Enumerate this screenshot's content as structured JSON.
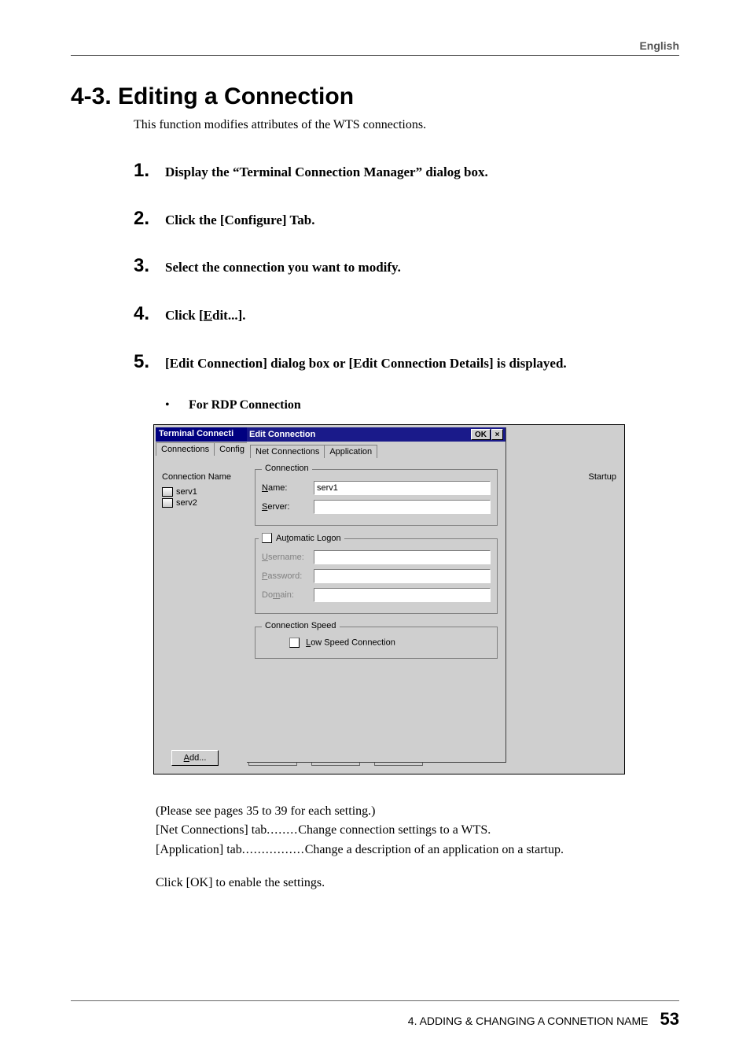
{
  "header": {
    "lang": "English"
  },
  "section": {
    "title": "4-3. Editing a Connection",
    "intro": "This function modifies attributes of the WTS connections."
  },
  "steps": [
    {
      "n": "1.",
      "t": "Display the “Terminal Connection Manager” dialog box."
    },
    {
      "n": "2.",
      "t": "Click the [Configure] Tab."
    },
    {
      "n": "3.",
      "t": "Select the connection you want to modify."
    },
    {
      "n": "4.",
      "t": "Click [Edit...]."
    },
    {
      "n": "5.",
      "t": "[Edit Connection] dialog box or [Edit Connection Details] is displayed."
    }
  ],
  "bullet": "For RDP Connection",
  "shot": {
    "backTitle": "Terminal Connecti",
    "backTabs": {
      "connections": "Connections",
      "configure": "Config"
    },
    "connNameHeader": "Connection Name",
    "entries": [
      "serv1",
      "serv2"
    ],
    "startupHeader": "Startup",
    "addBtn": "Add...",
    "front": {
      "title": "Edit Connection",
      "ok": "OK",
      "tabs": {
        "net": "Net Connections",
        "app": "Application"
      },
      "connection": {
        "legend": "Connection",
        "nameLabel": "Name:",
        "nameValue": "serv1",
        "serverLabel": "Server:",
        "serverValue": ""
      },
      "auto": {
        "legend": "Automatic Logon",
        "username": "Username:",
        "password": "Password:",
        "domain": "Domain:"
      },
      "speed": {
        "legend": "Connection Speed",
        "low": "Low Speed Connection"
      }
    }
  },
  "after": {
    "note": "(Please see pages 35 to 39 for each setting.)",
    "rows": [
      {
        "label": " [Net Connections] tab",
        "dots": "........",
        "desc": "Change connection settings to a WTS."
      },
      {
        "label": " [Application] tab",
        "dots": "................",
        "desc": "Change a description of an application on a startup."
      }
    ],
    "final": "Click [OK] to enable the settings."
  },
  "footer": {
    "chapter": "4. ADDING & CHANGING A CONNETION NAME",
    "page": "53"
  }
}
